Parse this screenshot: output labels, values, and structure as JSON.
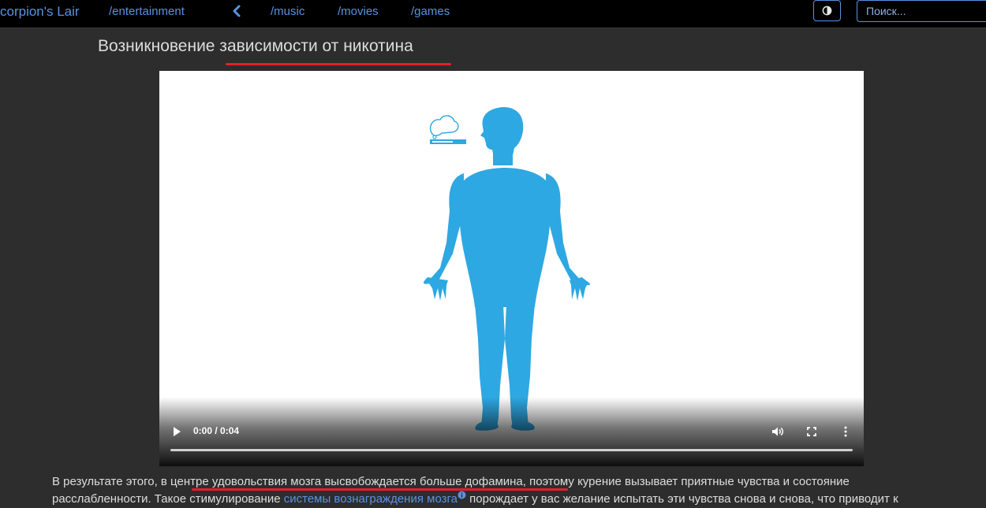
{
  "topbar": {
    "brand": "corpion's Lair",
    "nav": [
      {
        "label": "/entertainment"
      },
      {
        "label": "/music"
      },
      {
        "label": "/movies"
      },
      {
        "label": "/games"
      }
    ],
    "search_placeholder": "Поиск..."
  },
  "article": {
    "title": "Возникновение зависимости от никотина",
    "video": {
      "time": "0:00 / 0:04",
      "progress": 0
    },
    "paragraph": {
      "line1_before": "В результате этого, в центре удовольствия мозга высвобождается больше дофамина, поэтому курение вызывает приятные чувства и состояние",
      "line2_before": "расслабленности. Такое стимулирование ",
      "link": "системы вознаграждения мозга",
      "line2_after": " порождает у вас желание испытать эти чувства снова и снова, что приводит к"
    }
  },
  "colors": {
    "link": "#5a92e0",
    "underline": "#e0212b",
    "figure": "#2ea8e2",
    "background": "#2d2d2d"
  }
}
